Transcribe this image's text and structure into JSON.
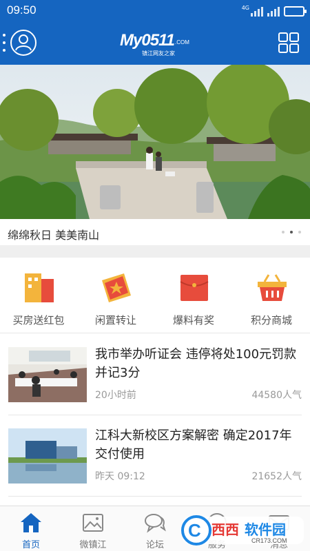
{
  "status_bar": {
    "time": "09:50",
    "network_label": "4G",
    "battery_level": 0.9
  },
  "header": {
    "logo_main": "My0511",
    "logo_suffix": ".COM",
    "logo_subtitle": "镇江网友之家",
    "avatar_icon": "user-avatar-icon",
    "menu_icon": "grid-menu-icon",
    "brand_color": "#1565c0"
  },
  "banner": {
    "caption": "绵绵秋日 美美南山",
    "slide_count": 3,
    "active_slide": 2
  },
  "quick_actions": [
    {
      "label": "买房送红包",
      "icon": "building-icon",
      "color": "#e74c3c"
    },
    {
      "label": "闲置转让",
      "icon": "ticket-star-icon",
      "color": "#e74c3c"
    },
    {
      "label": "爆料有奖",
      "icon": "red-envelope-icon",
      "color": "#e74c3c"
    },
    {
      "label": "积分商城",
      "icon": "shopping-basket-icon",
      "color": "#e74c3c"
    }
  ],
  "news": [
    {
      "title": "我市举办听证会 违停将处100元罚款并记3分",
      "time": "20小时前",
      "views": "44580人气"
    },
    {
      "title": "江科大新校区方案解密 确定2017年交付使用",
      "time": "昨天  09:12",
      "views": "21652人气"
    }
  ],
  "bottom_nav": [
    {
      "label": "首页",
      "icon": "home-icon",
      "active": true
    },
    {
      "label": "微镇江",
      "icon": "picture-icon",
      "active": false
    },
    {
      "label": "论坛",
      "icon": "chat-bubbles-icon",
      "active": false
    },
    {
      "label": "服务",
      "icon": "service-icon",
      "active": false
    },
    {
      "label": "消息",
      "icon": "mail-icon",
      "active": false
    }
  ],
  "watermark": {
    "brand": "西西软件园",
    "domain": "CR173.COM"
  }
}
